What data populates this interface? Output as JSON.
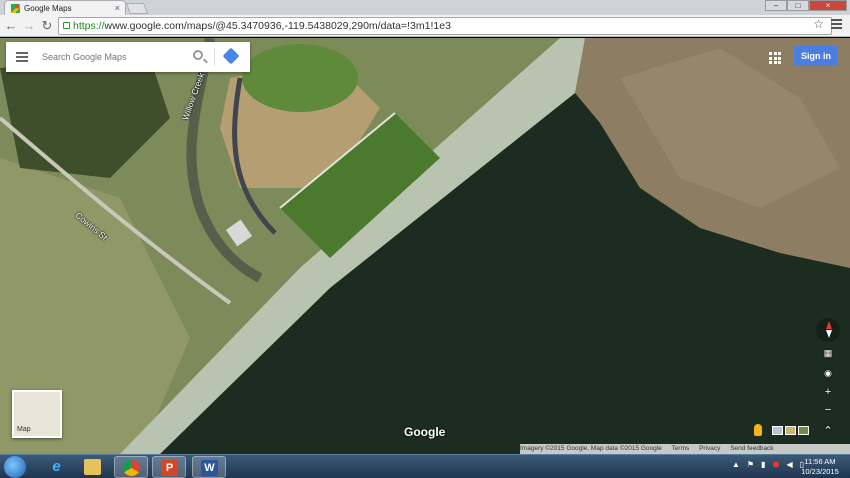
{
  "browser": {
    "tab_title": "Google Maps",
    "tab_close": "×",
    "url_scheme": "https://",
    "url_rest": "www.google.com/maps/@45.3470936,-119.5438029,290m/data=!3m1!1e3",
    "star": "☆",
    "win_min": "–",
    "win_max": "□",
    "win_close": "×"
  },
  "map": {
    "search_placeholder": "Search Google Maps",
    "sign_in_label": "Sign in",
    "road_labels": [
      "Willow Creek",
      "Cowins St"
    ],
    "minimap_label": "Map",
    "logo_text": "Google",
    "zoom_in": "+",
    "zoom_out": "−",
    "expand": "⌃",
    "footer": {
      "imagery": "Imagery ©2015 Google, Map data ©2015 Google",
      "terms": "Terms",
      "privacy": "Privacy",
      "feedback": "Send feedback"
    }
  },
  "taskbar": {
    "apps": [
      "ie-icon",
      "folder-icon",
      "chrome-icon",
      "powerpoint-icon",
      "word-icon"
    ],
    "ppt_letter": "P",
    "word_letter": "W",
    "ie_letter": "e",
    "clock_time": "11:56 AM",
    "clock_date": "10/23/2015",
    "tray_up": "▲"
  },
  "colors": {
    "water": "#1c2c20",
    "dam": "#b8c4b0",
    "hills": "#8c7d63",
    "grass": "#7d8a5a",
    "sign_in": "#4a7ee0"
  }
}
